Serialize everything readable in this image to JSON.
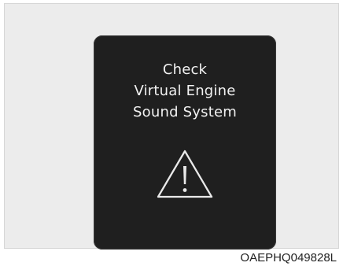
{
  "display": {
    "lines": [
      "Check",
      "Virtual Engine",
      "Sound System"
    ],
    "icon": "warning-triangle-icon",
    "colors": {
      "panel_background": "#1f1f1f",
      "text": "#f2f2f2",
      "outer_background": "#ececec"
    }
  },
  "caption": {
    "code": "OAEPHQ049828L"
  }
}
